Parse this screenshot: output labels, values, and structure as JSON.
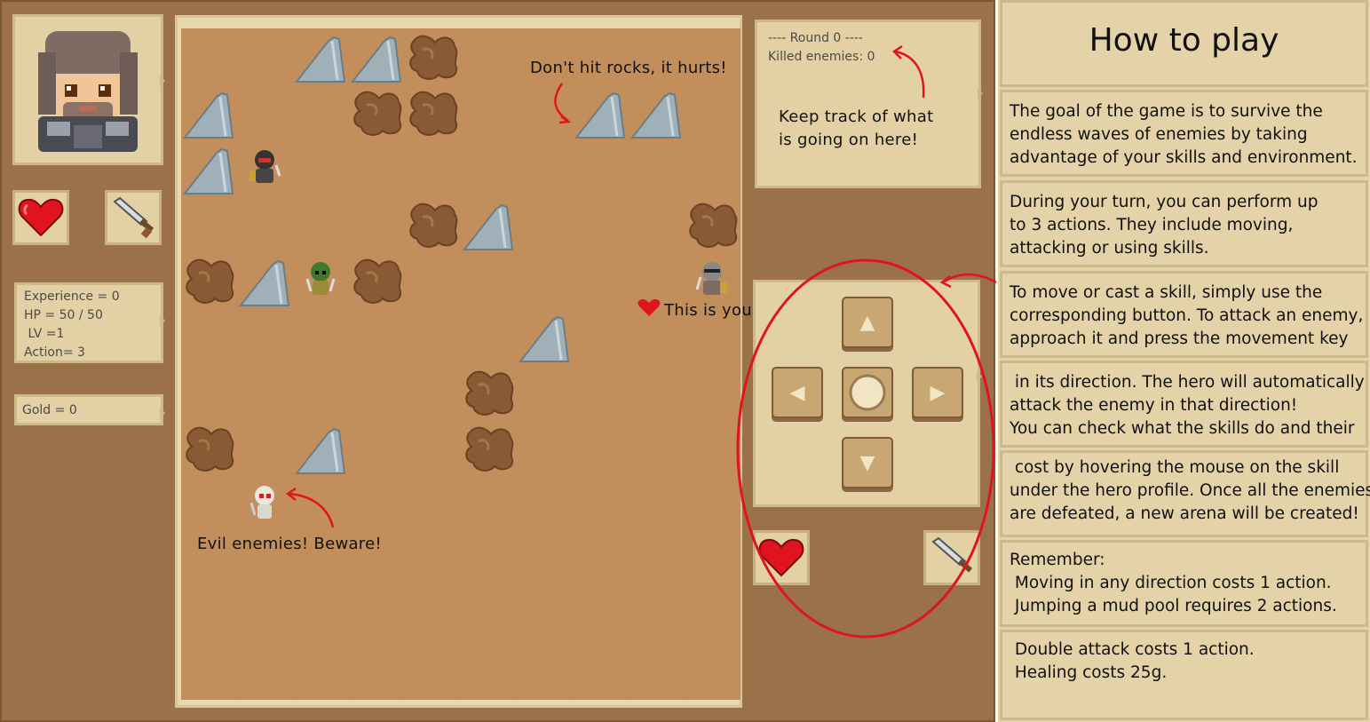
{
  "hero_stats": {
    "experience": "Experience = 0",
    "hp": "HP = 50 / 50",
    "lv": " LV =1",
    "action": "Action= 3",
    "gold": "Gold = 0"
  },
  "log": {
    "round": "---- Round 0 ----",
    "killed": "Killed enemies: 0"
  },
  "annotations": {
    "rocks": "Don't hit rocks, it hurts!",
    "log": "Keep track of what\nis going on here!",
    "player": "This is you!",
    "enemies": "Evil enemies! Beware!"
  },
  "controls": {
    "up": "▲",
    "left": "◀",
    "right": "▶",
    "down": "▼"
  },
  "help": {
    "title": "How to play",
    "p1": "The goal of the game is to survive the\nendless waves of enemies by taking\nadvantage of your skills and environment.",
    "p2": "During your turn, you can perform up\nto 3 actions. They include moving,\nattacking or using skills.",
    "p3": "To move or cast a skill, simply use the\ncorresponding button. To attack an enemy,\napproach it and press the movement key",
    "p4": " in its direction. The hero will automatically\nattack the enemy in that direction!\nYou can check what the skills do and their",
    "p5": " cost by hovering the mouse on the skill\nunder the hero profile. Once all the enemies\nare defeated, a new arena will be created!",
    "p6": "Remember:\n Moving in any direction costs 1 action.\n Jumping a mud pool requires 2 actions.",
    "p7": " Double attack costs 1 action.\n Healing costs 25g."
  },
  "colors": {
    "panel": "#e3d1a5",
    "board_floor": "#c28f5c",
    "annotation_red": "#e0141e"
  },
  "board": {
    "rocks": [
      [
        2,
        0
      ],
      [
        3,
        0
      ],
      [
        0,
        1
      ],
      [
        7,
        1
      ],
      [
        8,
        1
      ],
      [
        0,
        2
      ],
      [
        5,
        3
      ],
      [
        1,
        4
      ],
      [
        6,
        5
      ],
      [
        2,
        7
      ]
    ],
    "mud": [
      [
        4,
        0
      ],
      [
        3,
        1
      ],
      [
        4,
        1
      ],
      [
        4,
        3
      ],
      [
        9,
        3
      ],
      [
        0,
        4
      ],
      [
        3,
        4
      ],
      [
        5,
        6
      ],
      [
        0,
        7
      ],
      [
        5,
        7
      ]
    ],
    "enemies": [
      {
        "col": 1,
        "row": 2,
        "kind": "dark-knight"
      },
      {
        "col": 2,
        "row": 4,
        "kind": "goblin"
      },
      {
        "col": 1,
        "row": 8,
        "kind": "skeleton"
      }
    ],
    "player": {
      "col": 9,
      "row": 4
    }
  }
}
